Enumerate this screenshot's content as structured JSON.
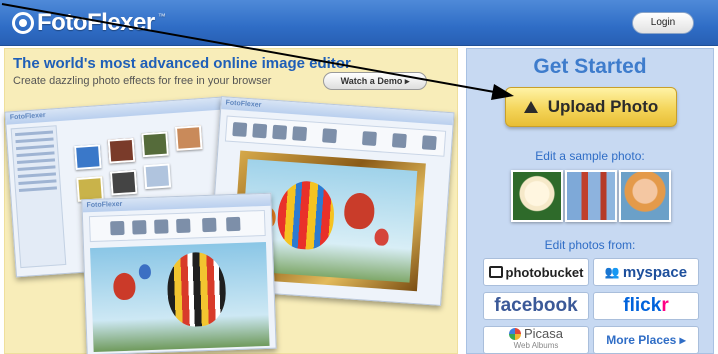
{
  "header": {
    "logo_text": "FotoFlexer",
    "logo_tm": "™",
    "login_label": "Login",
    "colors": {
      "bar": "#2f6dc6"
    }
  },
  "promo": {
    "title": "The world's most advanced online image editor",
    "subtitle": "Create dazzling photo effects for free in your browser",
    "demo_button": "Watch a Demo ▸"
  },
  "collage": {
    "screens": [
      {
        "name": "gallery-screenshot",
        "bar_label": "FotoFlexer"
      },
      {
        "name": "editor-screenshot-front",
        "bar_label": "FotoFlexer"
      },
      {
        "name": "editor-screenshot-back",
        "bar_label": "FotoFlexer"
      }
    ]
  },
  "get_started": {
    "title": "Get Started",
    "upload_label": "Upload Photo",
    "sample_label": "Edit a sample photo:",
    "samples": [
      "water-lily",
      "golden-gate-bridge",
      "smiling-girl"
    ],
    "from_label": "Edit photos from:",
    "services": {
      "photobucket": "photobucket",
      "myspace": "myspace",
      "facebook": "facebook",
      "flickr_a": "flick",
      "flickr_b": "r",
      "picasa": "Picasa",
      "picasa_sub": "Web Albums",
      "more": "More Places ▸"
    },
    "colors": {
      "panel": "#c7d9f2",
      "accent": "#3e7ccc",
      "upload": "#f4d55a"
    }
  }
}
